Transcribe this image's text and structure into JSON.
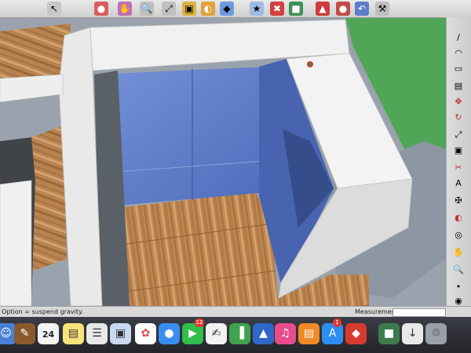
{
  "toolbar": {
    "icons": [
      "select-icon",
      "orbit-icon",
      "pan-icon",
      "zoom-icon",
      "zoom-extents-icon",
      "outliner-icon",
      "warehouse-icon",
      "extension-icon",
      "paint-icon",
      "section-icon",
      "walk-icon"
    ]
  },
  "side_toolbar": {
    "icons": [
      "line-icon",
      "arc-icon",
      "rectangle-icon",
      "push-pull-icon",
      "move-icon",
      "rotate-icon",
      "scale-icon",
      "offset-icon",
      "tape-icon",
      "text-icon",
      "axes-icon",
      "paint-bucket-icon",
      "orbit-icon",
      "pan-icon",
      "zoom-icon",
      "footprint-icon",
      "eye-icon"
    ]
  },
  "status_bar": {
    "message": "Option = suspend gravity.",
    "measurements_label": "Measurements",
    "measurements_value": ""
  },
  "dock": {
    "calendar_date": "24",
    "badges": {
      "app_store": "1",
      "facetime": "12"
    },
    "apps": [
      "finder",
      "notes",
      "calendar",
      "reminders",
      "preview",
      "photos",
      "messages",
      "facetime",
      "textedit",
      "numbers",
      "keynote",
      "itunes",
      "ibooks",
      "app-store",
      "sketchup",
      "image-capture",
      "downloads",
      "trash"
    ]
  },
  "colors": {
    "floor": "#b98552",
    "glass": "#5f7fcc",
    "wall": "#ececec",
    "lawn": "#4fa657"
  }
}
